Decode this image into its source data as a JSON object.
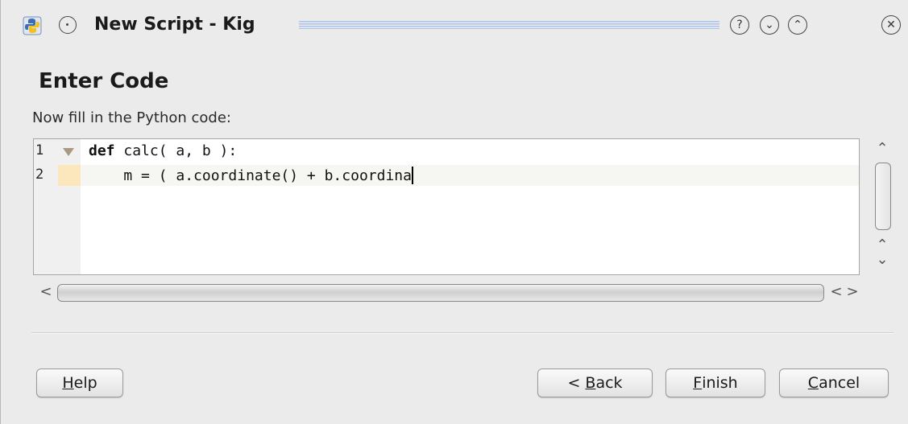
{
  "window": {
    "title": "New Script - Kig",
    "icons": {
      "app": "python-icon",
      "sticky": "circle-dot-icon",
      "help": "question-circle-icon",
      "minimize": "chevron-down-circle-icon",
      "maximize": "chevron-up-circle-icon",
      "close": "x-circle-icon"
    },
    "title_glyphs": {
      "help": "?",
      "minimize": "⌄",
      "maximize": "⌃",
      "close": "✕"
    }
  },
  "page": {
    "heading": "Enter Code",
    "instruction": "Now fill in the Python code:"
  },
  "editor": {
    "lines": [
      {
        "number": "1",
        "keyword": "def",
        "text": " calc( a, b ):"
      },
      {
        "number": "2",
        "keyword": "",
        "text": "    m = ( a.coordinate() + b.coordina"
      }
    ],
    "scroll_arrows": {
      "up": "⌃",
      "up2": "⌃",
      "down": "⌄",
      "left": "<",
      "right1": "<",
      "right2": ">"
    }
  },
  "buttons": {
    "help": {
      "pre": "",
      "accel": "H",
      "post": "elp"
    },
    "back": {
      "pre": "< ",
      "accel": "B",
      "post": "ack"
    },
    "finish": {
      "pre": "",
      "accel": "F",
      "post": "inish"
    },
    "cancel": {
      "pre": "",
      "accel": "C",
      "post": "ancel"
    }
  },
  "colors": {
    "title_accent": "#a9c3ea",
    "fold_marker": "#fce7bd"
  }
}
